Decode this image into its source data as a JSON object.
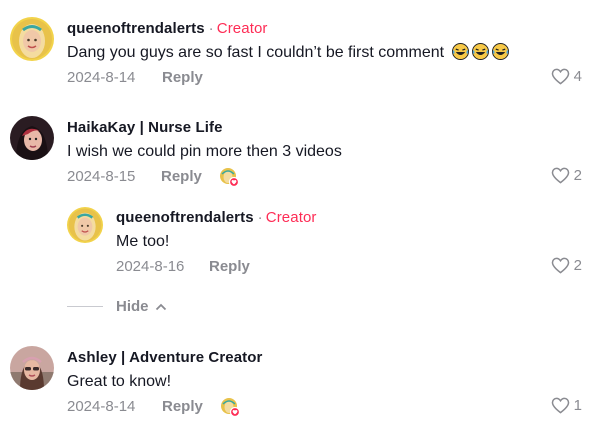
{
  "comments": [
    {
      "username": "queenoftrendalerts",
      "separator": "·",
      "badge": "Creator",
      "text": "Dang you guys are so fast I couldn’t be first comment",
      "emojis": [
        "laughing-emoji",
        "laughing-emoji",
        "laughing-emoji"
      ],
      "date": "2024-8-14",
      "reply_label": "Reply",
      "likes": "4"
    },
    {
      "username": "HaikaKay | Nurse Life",
      "text": "I wish we could pin more then 3 videos",
      "date": "2024-8-15",
      "reply_label": "Reply",
      "liked_by_creator": true,
      "likes": "2",
      "replies": [
        {
          "username": "queenoftrendalerts",
          "separator": "·",
          "badge": "Creator",
          "text": "Me too!",
          "date": "2024-8-16",
          "reply_label": "Reply",
          "likes": "2"
        }
      ],
      "hide_label": "Hide"
    },
    {
      "username": "Ashley | Adventure Creator",
      "text": "Great to know!",
      "date": "2024-8-14",
      "reply_label": "Reply",
      "liked_by_creator": true,
      "likes": "1"
    }
  ],
  "colors": {
    "creator_badge": "#fe2c55",
    "muted_text": "#8a8b91",
    "primary_text": "#161823"
  }
}
